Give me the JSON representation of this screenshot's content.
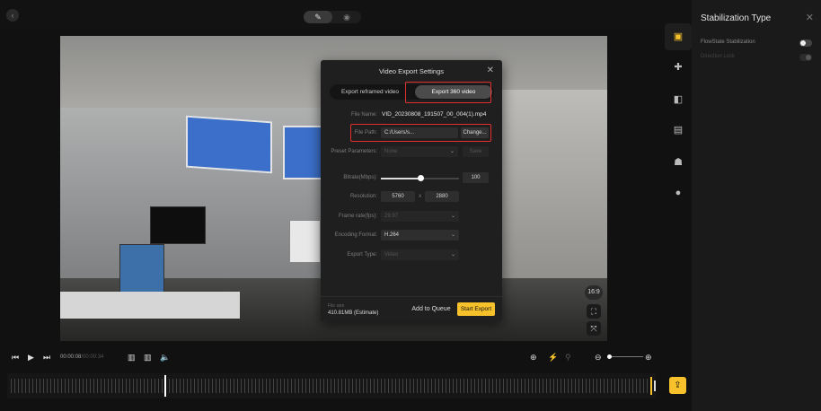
{
  "topbar": {
    "back_icon": "‹",
    "mode_edit_icon": "✎",
    "mode_view_icon": "◉"
  },
  "dialog": {
    "title": "Video Export Settings",
    "close_icon": "✕",
    "tabs": [
      {
        "label": "Export reframed video"
      },
      {
        "label": "Export 360 video"
      }
    ],
    "file_name_label": "File Name:",
    "file_name_value": "VID_20230808_191507_00_004(1).mp4",
    "file_path_label": "File Path:",
    "file_path_value": "C:/Users/s...",
    "change_button": "Change...",
    "preset_label": "Preset Parameters:",
    "preset_value": "None",
    "save_button": "Save",
    "bitrate_label": "Bitrate(Mbps):",
    "bitrate_value": "100",
    "bitrate_fraction": 0.5,
    "resolution_label": "Resolution:",
    "resolution_w": "5760",
    "resolution_x": "x",
    "resolution_h": "2880",
    "frame_rate_label": "Frame rate(fps):",
    "frame_rate_value": "29.97",
    "encoding_label": "Encoding Format:",
    "encoding_value": "H.264",
    "export_type_label": "Export Type:",
    "export_type_value": "Video",
    "file_size_label": "File size",
    "file_size_value": "410.81MB (Estimate)",
    "queue_button": "Add to Queue",
    "start_button": "Start Export"
  },
  "video_overlay": {
    "ratio_badge": "16:9"
  },
  "right_panel": {
    "title": "Stabilization Type",
    "close_icon": "✕",
    "options": [
      {
        "label": "FlowState Stabilization",
        "enabled": true
      },
      {
        "label": "Direction Lock",
        "enabled": false
      }
    ]
  },
  "side_icons": [
    "stabilize-icon",
    "puzzle-icon",
    "adjust-icon",
    "filter-icon",
    "people-icon",
    "info-icon"
  ],
  "controls": {
    "current_time": "00:00:08",
    "duration": "/00:00:34",
    "prev_icon": "⏮",
    "play_icon": "▶",
    "next_icon": "⏭",
    "volume_icon": "🔈",
    "add_icon": "⊕",
    "zoom_out_icon": "⊖",
    "zoom_in_icon": "⊕"
  },
  "timeline": {
    "playhead_fraction": 0.24
  },
  "export_icon": "⇪",
  "colors": {
    "accent": "#f6c12a",
    "highlight": "#e0312f",
    "dialog_bg": "#1f1f1f"
  }
}
